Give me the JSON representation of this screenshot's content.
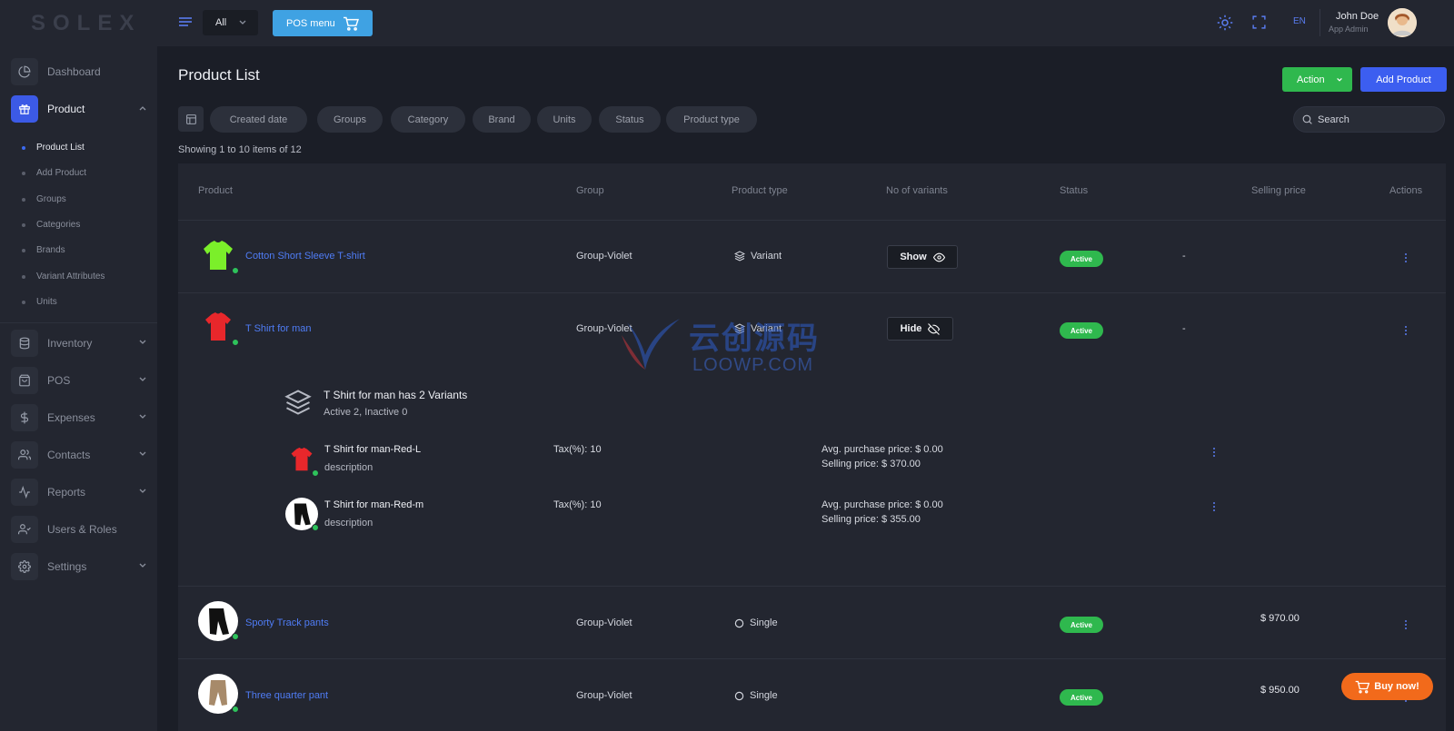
{
  "app": {
    "logo": "SOLEX"
  },
  "topbar": {
    "store_select": "All",
    "pos_button": "POS menu",
    "language": "EN",
    "user_name": "John Doe",
    "user_role": "App Admin"
  },
  "sidebar": {
    "items": [
      {
        "label": "Dashboard",
        "icon": "pie-chart-icon"
      },
      {
        "label": "Product",
        "icon": "gift-icon",
        "active": true
      },
      {
        "label": "Inventory",
        "icon": "database-icon"
      },
      {
        "label": "POS",
        "icon": "shopping-bag-icon"
      },
      {
        "label": "Expenses",
        "icon": "dollar-icon"
      },
      {
        "label": "Contacts",
        "icon": "users-icon"
      },
      {
        "label": "Reports",
        "icon": "activity-icon"
      },
      {
        "label": "Users & Roles",
        "icon": "user-check-icon"
      },
      {
        "label": "Settings",
        "icon": "gear-icon"
      }
    ],
    "product_sub": [
      "Product List",
      "Add Product",
      "Groups",
      "Categories",
      "Brands",
      "Variant Attributes",
      "Units"
    ]
  },
  "page": {
    "title": "Product List",
    "action_button": "Action",
    "add_button": "Add Product",
    "filters": [
      "Created date",
      "Groups",
      "Category",
      "Brand",
      "Units",
      "Status",
      "Product type"
    ],
    "search_placeholder": "Search",
    "showing": "Showing 1 to 10 items of 12"
  },
  "table": {
    "headers": [
      "Product",
      "Group",
      "Product type",
      "No of variants",
      "Status",
      "Selling price",
      "Actions"
    ],
    "rows": [
      {
        "name": "Cotton Short Sleeve T-shirt",
        "group": "Group-Violet",
        "type": "Variant",
        "variants_button": "Show",
        "status": "Active",
        "price": "-"
      },
      {
        "name": "T Shirt for man",
        "group": "Group-Violet",
        "type": "Variant",
        "variants_button": "Hide",
        "status": "Active",
        "price": "-"
      },
      {
        "name": "Sporty Track pants",
        "group": "Group-Violet",
        "type": "Single",
        "status": "Active",
        "price": "$ 970.00"
      },
      {
        "name": "Three quarter pant",
        "group": "Group-Violet",
        "type": "Single",
        "status": "Active",
        "price": "$ 950.00"
      }
    ],
    "expanded": {
      "title": "T Shirt for man has 2 Variants",
      "subtitle": "Active 2, Inactive 0",
      "variants": [
        {
          "name": "T Shirt for man-Red-L",
          "desc": "description",
          "tax": "Tax(%): 10",
          "avg_purchase": "Avg. purchase price:  $ 0.00",
          "selling": "Selling price: $ 370.00"
        },
        {
          "name": "T Shirt for man-Red-m",
          "desc": "description",
          "tax": "Tax(%): 10",
          "avg_purchase": "Avg. purchase price:  $ 0.00",
          "selling": "Selling price: $ 355.00"
        }
      ]
    }
  },
  "watermark": {
    "line1": "云创源码",
    "line2": "LOOWP.COM"
  },
  "buy_now": "Buy now!"
}
